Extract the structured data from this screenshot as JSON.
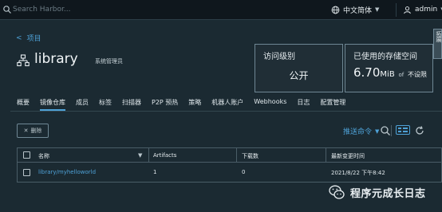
{
  "topbar": {
    "search_placeholder": "Search Harbor...",
    "language": "中文简体",
    "user": "admin"
  },
  "nav": {
    "back_label": "项目"
  },
  "project": {
    "name": "library",
    "role": "系统管理员"
  },
  "cards": {
    "access_label": "访问级别",
    "access_value": "公开",
    "storage_label": "已使用的存储空间",
    "storage_value": "6.70",
    "storage_unit": "MiB",
    "storage_of": "of",
    "storage_limit": "不设限"
  },
  "side_tab": {
    "label": "拓展"
  },
  "tabs": [
    {
      "label": "概要"
    },
    {
      "label": "镜像仓库"
    },
    {
      "label": "成员"
    },
    {
      "label": "标签"
    },
    {
      "label": "扫描器"
    },
    {
      "label": "P2P 预热"
    },
    {
      "label": "策略"
    },
    {
      "label": "机器人账户"
    },
    {
      "label": "Webhooks"
    },
    {
      "label": "日志"
    },
    {
      "label": "配置管理"
    }
  ],
  "toolbar": {
    "delete_label": "删除",
    "push_label": "推送命令"
  },
  "table": {
    "headers": [
      "名称",
      "Artifacts",
      "下载数",
      "最新变更时间"
    ],
    "rows": [
      {
        "name": "library/myhelloworld",
        "artifacts": "1",
        "pulls": "0",
        "updated": "2021/8/22 下午8:42"
      }
    ]
  },
  "watermark": {
    "text": "程序元成长日志"
  },
  "colors": {
    "accent": "#4ea2d8",
    "background": "#1b2a32",
    "topbar": "#0f171d"
  }
}
